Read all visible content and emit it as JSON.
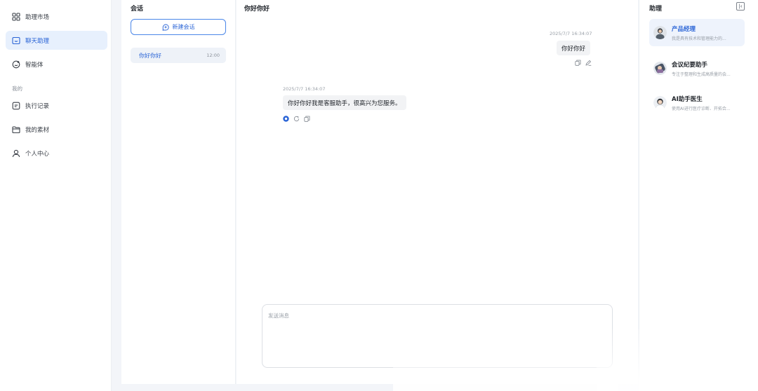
{
  "nav": {
    "items": [
      {
        "label": "助理市场",
        "icon": "grid-icon"
      },
      {
        "label": "聊天助理",
        "icon": "chat-bubble-icon"
      },
      {
        "label": "智能体",
        "icon": "agent-icon"
      }
    ],
    "section_label": "我的",
    "mine": [
      {
        "label": "执行记录",
        "icon": "record-icon"
      },
      {
        "label": "我的素材",
        "icon": "folder-icon"
      },
      {
        "label": "个人中心",
        "icon": "user-icon"
      }
    ]
  },
  "sessions": {
    "title": "会话",
    "new_chat_label": "新建会话",
    "items": [
      {
        "title": "你好你好",
        "time": "12:00"
      }
    ]
  },
  "chat": {
    "title": "你好你好",
    "messages": [
      {
        "role": "user",
        "timestamp": "2025/7/7 16:34:07",
        "text": "你好你好"
      },
      {
        "role": "assistant",
        "timestamp": "2025/7/7 16:34:07",
        "text": "你好你好我是客服助手，很高兴为您服务。"
      }
    ],
    "composer_placeholder": "发送消息"
  },
  "assistants": {
    "title": "助理",
    "items": [
      {
        "name": "产品经理",
        "desc": "我是具有技术和管理能力的..."
      },
      {
        "name": "会议纪要助手",
        "desc": "专注于整理和生成高质量的会..."
      },
      {
        "name": "AI助手医生",
        "desc": "使用AI进行医疗诊断、开拓合..."
      }
    ]
  },
  "colors": {
    "accent": "#2a64d6",
    "active_bg": "#e7f0fd",
    "bubble_bg": "#f2f3f5"
  }
}
